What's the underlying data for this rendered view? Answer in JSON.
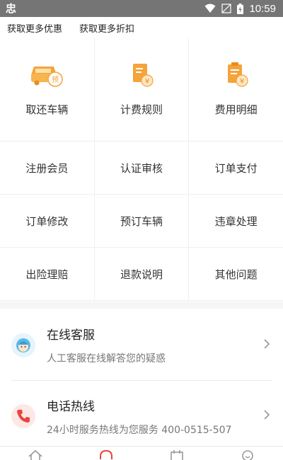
{
  "status_bar": {
    "app_glyph": "忠",
    "time": "10:59",
    "icons": [
      "wifi-icon",
      "no-signal-icon",
      "battery-charging-icon"
    ]
  },
  "promo": {
    "link_1": "获取更多优惠",
    "link_2": "获取更多折扣"
  },
  "features": [
    {
      "label": "取还车辆",
      "icon": "car-reserve-icon"
    },
    {
      "label": "计费规则",
      "icon": "billing-rules-icon"
    },
    {
      "label": "费用明细",
      "icon": "fee-details-icon"
    }
  ],
  "grid_rows": [
    [
      {
        "label": "注册会员"
      },
      {
        "label": "认证审核"
      },
      {
        "label": "订单支付"
      }
    ],
    [
      {
        "label": "订单修改"
      },
      {
        "label": "预订车辆"
      },
      {
        "label": "违章处理"
      }
    ],
    [
      {
        "label": "出险理赔"
      },
      {
        "label": "退款说明"
      },
      {
        "label": "其他问题"
      }
    ]
  ],
  "contacts": [
    {
      "title": "在线客服",
      "subtitle": "人工客服在线解答您的疑惑",
      "icon": "customer-service-icon"
    },
    {
      "title": "电话热线",
      "subtitle": "24小时服务热线为您服务 400-0515-507",
      "icon": "phone-icon"
    }
  ],
  "bottom_nav": {
    "icons": [
      "home-icon",
      "headset-icon",
      "calendar-icon",
      "profile-icon"
    ],
    "active_color": "#e8453c"
  },
  "colors": {
    "accent_orange": "#f5a33b",
    "accent_red": "#e8453c",
    "status_bar": "#757575"
  }
}
